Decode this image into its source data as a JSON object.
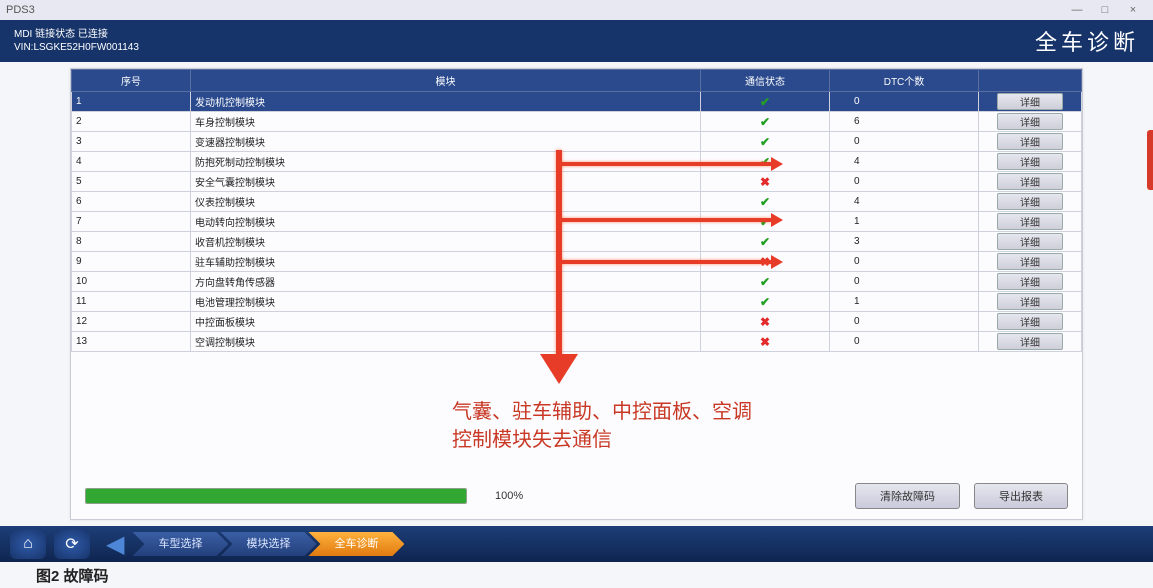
{
  "window": {
    "title": "PDS3",
    "min": "—",
    "max": "□",
    "close": "×"
  },
  "header": {
    "line1": "MDI 链接状态    已连接",
    "line2": "VIN:LSGKE52H0FW001143",
    "title": "全车诊断"
  },
  "columns": {
    "idx": "序号",
    "module": "模块",
    "comm": "通信状态",
    "dtc": "DTC个数",
    "detail": ""
  },
  "rows": [
    {
      "i": "1",
      "m": "发动机控制模块",
      "ok": true,
      "dtc": "0",
      "sel": true
    },
    {
      "i": "2",
      "m": "车身控制模块",
      "ok": true,
      "dtc": "6"
    },
    {
      "i": "3",
      "m": "变速器控制模块",
      "ok": true,
      "dtc": "0"
    },
    {
      "i": "4",
      "m": "防抱死制动控制模块",
      "ok": true,
      "dtc": "4"
    },
    {
      "i": "5",
      "m": "安全气囊控制模块",
      "ok": false,
      "dtc": "0"
    },
    {
      "i": "6",
      "m": "仪表控制模块",
      "ok": true,
      "dtc": "4"
    },
    {
      "i": "7",
      "m": "电动转向控制模块",
      "ok": true,
      "dtc": "1"
    },
    {
      "i": "8",
      "m": "收音机控制模块",
      "ok": true,
      "dtc": "3"
    },
    {
      "i": "9",
      "m": "驻车辅助控制模块",
      "ok": false,
      "dtc": "0"
    },
    {
      "i": "10",
      "m": "方向盘转角传感器",
      "ok": true,
      "dtc": "0"
    },
    {
      "i": "11",
      "m": "电池管理控制模块",
      "ok": true,
      "dtc": "1"
    },
    {
      "i": "12",
      "m": "中控面板模块",
      "ok": false,
      "dtc": "0"
    },
    {
      "i": "13",
      "m": "空调控制模块",
      "ok": false,
      "dtc": "0"
    }
  ],
  "detail_label": "详细",
  "progress": {
    "percent": 100,
    "text": "100%"
  },
  "buttons": {
    "clear": "清除故障码",
    "export": "导出报表"
  },
  "crumbs": {
    "a": "车型选择",
    "b": "模块选择",
    "c": "全车诊断"
  },
  "annotation": {
    "l1": "气囊、驻车辅助、中控面板、空调",
    "l2": "控制模块失去通信"
  },
  "caption": "图2  故障码"
}
